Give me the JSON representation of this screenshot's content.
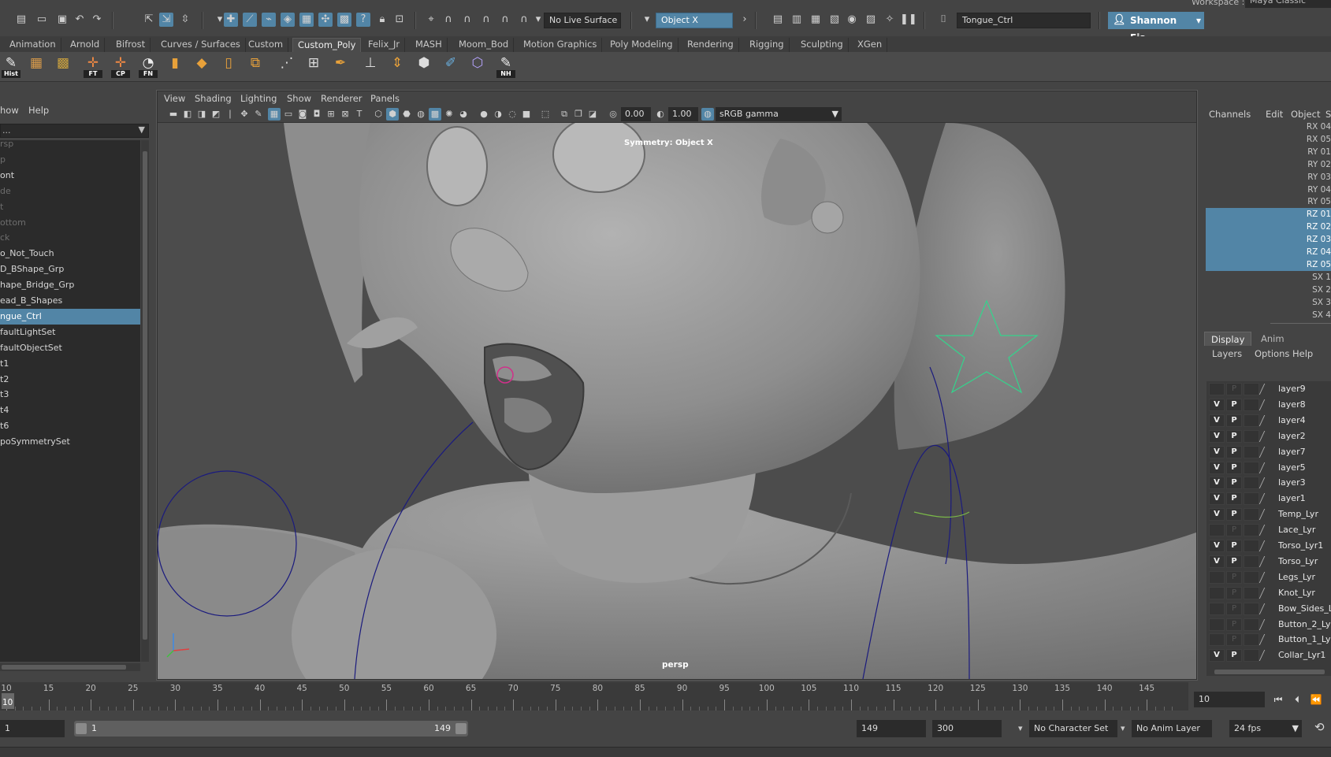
{
  "workspace": {
    "label": "Workspace :",
    "value": "Maya Classic"
  },
  "statusbar": {
    "live_surface": "No Live Surface",
    "symmetry": "Object X",
    "selection_field": "Tongue_Ctrl",
    "user": "Shannon Fis..."
  },
  "shelf_tabs": [
    "Animation",
    "Arnold",
    "Bifrost",
    "Curves / Surfaces",
    "Custom",
    "Custom_Poly",
    "Felix_Jr",
    "MASH",
    "Moom_Bod",
    "Motion Graphics",
    "Poly Modeling",
    "Rendering",
    "Rigging",
    "Sculpting",
    "XGen"
  ],
  "shelf_active": "Custom_Poly",
  "shelf_captions": {
    "hist": "Hist",
    "ft": "FT",
    "cp": "CP",
    "fn": "FN",
    "nh": "NH"
  },
  "outliner": {
    "menu": [
      "how",
      "Help"
    ],
    "search": "...",
    "items": [
      {
        "label": "rsp",
        "dim": true
      },
      {
        "label": "p",
        "dim": true
      },
      {
        "label": "ont",
        "dim": false
      },
      {
        "label": "de",
        "dim": true
      },
      {
        "label": "t",
        "dim": true
      },
      {
        "label": "ottom",
        "dim": true
      },
      {
        "label": "ck",
        "dim": true
      },
      {
        "label": "o_Not_Touch",
        "dim": false
      },
      {
        "label": "D_BShape_Grp",
        "dim": false
      },
      {
        "label": "hape_Bridge_Grp",
        "dim": false
      },
      {
        "label": "ead_B_Shapes",
        "dim": false
      },
      {
        "label": "ngue_Ctrl",
        "dim": false,
        "selected": true
      },
      {
        "label": "faultLightSet",
        "dim": false
      },
      {
        "label": "faultObjectSet",
        "dim": false
      },
      {
        "label": "t1",
        "dim": false
      },
      {
        "label": "t2",
        "dim": false
      },
      {
        "label": "t3",
        "dim": false
      },
      {
        "label": "t4",
        "dim": false
      },
      {
        "label": "t6",
        "dim": false
      },
      {
        "label": "poSymmetrySet",
        "dim": false
      }
    ]
  },
  "viewport": {
    "menu": [
      "View",
      "Shading",
      "Lighting",
      "Show",
      "Renderer",
      "Panels"
    ],
    "exposure": "0.00",
    "gamma": "1.00",
    "color_space": "sRGB gamma",
    "symmetry_label": "Symmetry: Object X",
    "camera_label": "persp"
  },
  "channelbox": {
    "menu": [
      "Channels",
      "Edit",
      "Object",
      "S"
    ],
    "rows": [
      {
        "label": "RX 04",
        "selected": false
      },
      {
        "label": "RX 05",
        "selected": false
      },
      {
        "label": "RY 01",
        "selected": false
      },
      {
        "label": "RY 02",
        "selected": false
      },
      {
        "label": "RY 03",
        "selected": false
      },
      {
        "label": "RY 04",
        "selected": false
      },
      {
        "label": "RY 05",
        "selected": false
      },
      {
        "label": "RZ 01",
        "selected": true
      },
      {
        "label": "RZ 02",
        "selected": true
      },
      {
        "label": "RZ 03",
        "selected": true
      },
      {
        "label": "RZ 04",
        "selected": true
      },
      {
        "label": "RZ 05",
        "selected": true
      },
      {
        "label": "SX 1",
        "selected": false
      },
      {
        "label": "SX 2",
        "selected": false
      },
      {
        "label": "SX 3",
        "selected": false
      },
      {
        "label": "SX 4",
        "selected": false
      }
    ]
  },
  "layer_editor": {
    "tabs": [
      "Display",
      "Anim"
    ],
    "menu": [
      "Layers",
      "Options",
      "Help"
    ],
    "layers": [
      {
        "name": "layer9",
        "v": "",
        "p": "P"
      },
      {
        "name": "layer8",
        "v": "V",
        "p": "P"
      },
      {
        "name": "layer4",
        "v": "V",
        "p": "P"
      },
      {
        "name": "layer2",
        "v": "V",
        "p": "P"
      },
      {
        "name": "layer7",
        "v": "V",
        "p": "P"
      },
      {
        "name": "layer5",
        "v": "V",
        "p": "P"
      },
      {
        "name": "layer3",
        "v": "V",
        "p": "P"
      },
      {
        "name": "layer1",
        "v": "V",
        "p": "P"
      },
      {
        "name": "Temp_Lyr",
        "v": "V",
        "p": "P"
      },
      {
        "name": "Lace_Lyr",
        "v": "",
        "p": "P"
      },
      {
        "name": "Torso_Lyr1",
        "v": "V",
        "p": "P"
      },
      {
        "name": "Torso_Lyr",
        "v": "V",
        "p": "P"
      },
      {
        "name": "Legs_Lyr",
        "v": "",
        "p": "P"
      },
      {
        "name": "Knot_Lyr",
        "v": "",
        "p": "P"
      },
      {
        "name": "Bow_Sides_L",
        "v": "",
        "p": "P"
      },
      {
        "name": "Button_2_Lyr",
        "v": "",
        "p": "P"
      },
      {
        "name": "Button_1_Lyr",
        "v": "",
        "p": "P"
      },
      {
        "name": "Collar_Lyr1",
        "v": "V",
        "p": "P"
      }
    ]
  },
  "timeslider": {
    "ticks": [
      "10",
      "15",
      "20",
      "25",
      "30",
      "35",
      "40",
      "45",
      "50",
      "55",
      "60",
      "65",
      "70",
      "75",
      "80",
      "85",
      "90",
      "95",
      "100",
      "105",
      "110",
      "115",
      "120",
      "125",
      "130",
      "135",
      "140",
      "145"
    ],
    "current_frame": "10",
    "current_time_field": "10"
  },
  "rangeslider": {
    "start_field": "1",
    "range_start": "1",
    "range_end": "149",
    "end_field": "149",
    "anim_end_field": "300",
    "character_set": "No Character Set",
    "anim_layer": "No Anim Layer",
    "fps": "24 fps"
  }
}
